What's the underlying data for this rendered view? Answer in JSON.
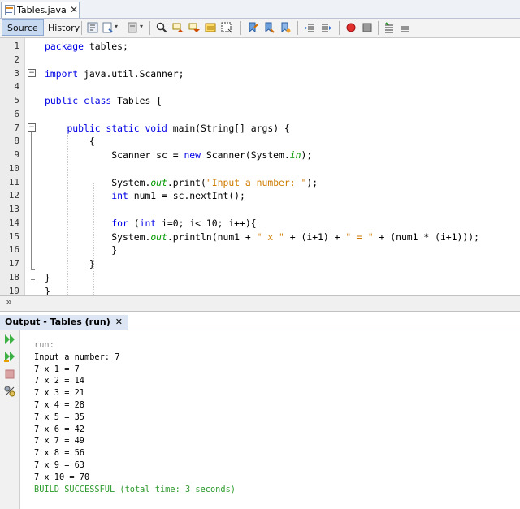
{
  "file_tab": {
    "label": "Tables.java",
    "close": "✕"
  },
  "editor_toolbar": {
    "source": "Source",
    "history": "History"
  },
  "line_numbers": [
    "1",
    "2",
    "3",
    "4",
    "5",
    "6",
    "7",
    "8",
    "9",
    "10",
    "11",
    "12",
    "13",
    "14",
    "15",
    "16",
    "17",
    "18",
    "19"
  ],
  "code_lines": [
    [
      {
        "t": "package",
        "c": "kw"
      },
      {
        "t": " tables;",
        "c": ""
      }
    ],
    [],
    [
      {
        "t": "import",
        "c": "kw"
      },
      {
        "t": " java.util.Scanner;",
        "c": ""
      }
    ],
    [],
    [
      {
        "t": "public class",
        "c": "kw"
      },
      {
        "t": " Tables {",
        "c": ""
      }
    ],
    [],
    [
      {
        "t": "    ",
        "c": ""
      },
      {
        "t": "public static void",
        "c": "kw"
      },
      {
        "t": " main(String[] args) {",
        "c": ""
      }
    ],
    [
      {
        "t": "        {",
        "c": ""
      }
    ],
    [
      {
        "t": "            Scanner sc = ",
        "c": ""
      },
      {
        "t": "new",
        "c": "kw"
      },
      {
        "t": " Scanner(System.",
        "c": ""
      },
      {
        "t": "in",
        "c": "fld"
      },
      {
        "t": ");",
        "c": ""
      }
    ],
    [],
    [
      {
        "t": "            System.",
        "c": ""
      },
      {
        "t": "out",
        "c": "fld"
      },
      {
        "t": ".print(",
        "c": ""
      },
      {
        "t": "\"Input a number: \"",
        "c": "str"
      },
      {
        "t": ");",
        "c": ""
      }
    ],
    [
      {
        "t": "            ",
        "c": ""
      },
      {
        "t": "int",
        "c": "kw"
      },
      {
        "t": " num1 = sc.nextInt();",
        "c": ""
      }
    ],
    [],
    [
      {
        "t": "            ",
        "c": ""
      },
      {
        "t": "for",
        "c": "kw"
      },
      {
        "t": " (",
        "c": ""
      },
      {
        "t": "int",
        "c": "kw"
      },
      {
        "t": " i=0; i< 10; i++){",
        "c": ""
      }
    ],
    [
      {
        "t": "            System.",
        "c": ""
      },
      {
        "t": "out",
        "c": "fld"
      },
      {
        "t": ".println(num1 + ",
        "c": ""
      },
      {
        "t": "\" x \"",
        "c": "str"
      },
      {
        "t": " + (i+1) + ",
        "c": ""
      },
      {
        "t": "\" = \"",
        "c": "str"
      },
      {
        "t": " + (num1 * (i+1)));",
        "c": ""
      }
    ],
    [
      {
        "t": "            }",
        "c": ""
      }
    ],
    [
      {
        "t": "        }",
        "c": ""
      }
    ],
    [
      {
        "t": "}",
        "c": ""
      }
    ],
    [
      {
        "t": "}",
        "c": ""
      }
    ]
  ],
  "output": {
    "tab_label": "Output - Tables (run)",
    "close": "✕",
    "lines": [
      {
        "text": "run:",
        "style": "gray"
      },
      {
        "text": "Input a number: 7",
        "style": ""
      },
      {
        "text": "7 x 1 = 7",
        "style": ""
      },
      {
        "text": "7 x 2 = 14",
        "style": ""
      },
      {
        "text": "7 x 3 = 21",
        "style": ""
      },
      {
        "text": "7 x 4 = 28",
        "style": ""
      },
      {
        "text": "7 x 5 = 35",
        "style": ""
      },
      {
        "text": "7 x 6 = 42",
        "style": ""
      },
      {
        "text": "7 x 7 = 49",
        "style": ""
      },
      {
        "text": "7 x 8 = 56",
        "style": ""
      },
      {
        "text": "7 x 9 = 63",
        "style": ""
      },
      {
        "text": "7 x 10 = 70",
        "style": ""
      },
      {
        "text": "BUILD SUCCESSFUL (total time: 3 seconds)",
        "style": "green"
      }
    ]
  },
  "colors": {
    "keyword": "#0000e6",
    "string": "#ce7b00",
    "field": "#009900",
    "success": "#2e9b2e"
  },
  "icons": {
    "toolbar": [
      "last-edit-icon",
      "back-icon",
      "forward-icon",
      "find-selection-icon",
      "find-previous-icon",
      "find-next-icon",
      "toggle-highlight-icon",
      "toggle-rectangular-selection-icon",
      "previous-bookmark-icon",
      "next-bookmark-icon",
      "toggle-bookmark-icon",
      "shift-left-icon",
      "shift-right-icon",
      "start-macro-icon",
      "stop-macro-icon",
      "comment-icon",
      "uncomment-icon"
    ],
    "output_side": [
      "rerun-icon",
      "rerun-with-args-icon",
      "stop-icon",
      "settings-icon"
    ]
  }
}
